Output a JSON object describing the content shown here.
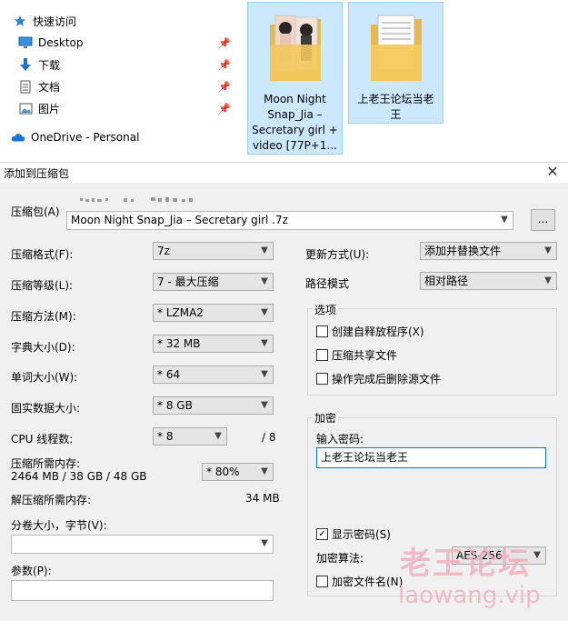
{
  "explorer": {
    "nav": [
      {
        "label": "快速访问",
        "icon": "star-icon"
      },
      {
        "label": "Desktop",
        "icon": "desktop-icon"
      },
      {
        "label": "下载",
        "icon": "download-icon"
      },
      {
        "label": "文档",
        "icon": "document-icon"
      },
      {
        "label": "图片",
        "icon": "pictures-icon"
      },
      {
        "label": "OneDrive - Personal",
        "icon": "cloud-icon"
      }
    ],
    "files": [
      {
        "name_lines": [
          "Moon Night",
          "Snap_Jia –",
          "Secretary girl +",
          "video [77P+1..."
        ]
      },
      {
        "name_lines": [
          "上老王论坛当老",
          "王"
        ]
      }
    ]
  },
  "dialog": {
    "title": "添加到压缩包",
    "archive_label": "压缩包(A)",
    "archive_name": "Moon Night Snap_Jia – Secretary girl .7z",
    "browse_label": "...",
    "format_label": "压缩格式(F):",
    "format_value": "7z",
    "level_label": "压缩等级(L):",
    "level_value": "7 - 最大压缩",
    "method_label": "压缩方法(M):",
    "method_value": "*  LZMA2",
    "dict_label": "字典大小(D):",
    "dict_value": "*  32 MB",
    "word_label": "单词大小(W):",
    "word_value": "*  64",
    "solid_label": "固实数据大小:",
    "solid_value": "*  8 GB",
    "cpu_label": "CPU 线程数:",
    "cpu_value": "*  8",
    "cpu_total": "/ 8",
    "mem_label": "压缩所需内存:",
    "mem_value": "2464 MB / 38 GB / 48 GB",
    "mem_percent": "* 80%",
    "decomp_label": "解压缩所需内存:",
    "decomp_value": "34 MB",
    "volume_label": "分卷大小，字节(V):",
    "volume_value": "",
    "params_label": "参数(P):",
    "params_value": "",
    "update_label": "更新方式(U):",
    "update_value": "添加并替换文件",
    "path_label": "路径模式",
    "path_value": "相对路径",
    "options_title": "选项",
    "options": [
      {
        "label": "创建自释放程序(X)",
        "checked": false
      },
      {
        "label": "压缩共享文件",
        "checked": false
      },
      {
        "label": "操作完成后删除源文件",
        "checked": false
      }
    ],
    "encrypt_title": "加密",
    "password_label": "输入密码:",
    "password_value": "上老王论坛当老王",
    "show_password_label": "显示密码(S)",
    "show_password_checked": true,
    "enc_method_label": "加密算法:",
    "enc_method_value": "AES-256",
    "encrypt_names_label": "加密文件名(N)",
    "encrypt_names_checked": false
  },
  "watermark": {
    "line1": "老王论坛",
    "line2": "laowang.vip"
  },
  "colors": {
    "accent": "#0078d7",
    "selection": "#cce8ff",
    "watermark": "#f0a9ba"
  }
}
